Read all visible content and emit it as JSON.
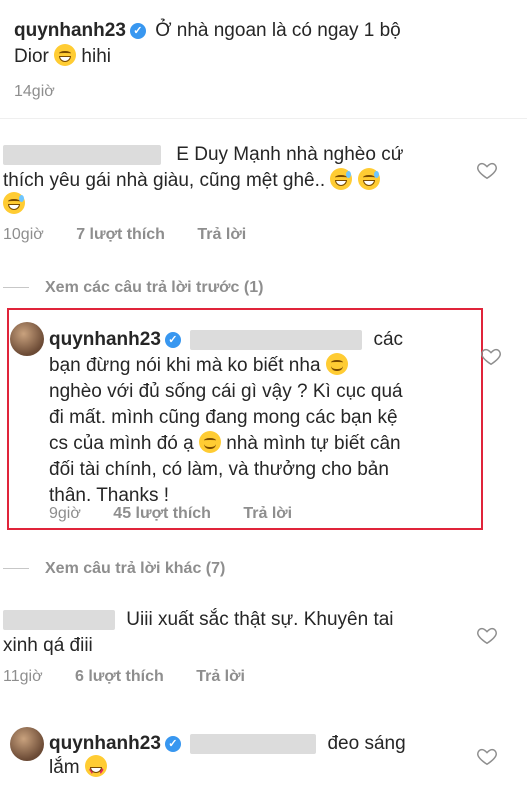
{
  "post": {
    "username": "quynhanh23",
    "caption_line1": "Ở nhà ngoan là có ngay 1 bộ",
    "caption_line2_a": "Dior",
    "caption_line2_b": "hihi",
    "time": "14giờ"
  },
  "comment1": {
    "line1": "E Duy Mạnh nhà nghèo cứ",
    "line2": "thích yêu gái nhà giàu, cũng mệt ghê..",
    "time": "10giờ",
    "likes": "7 lượt thích",
    "reply": "Trả lời"
  },
  "view_previous": "Xem các câu trả lời trước (1)",
  "reply1": {
    "username": "quynhanh23",
    "line1": "các",
    "line2": "bạn đừng nói khi mà ko biết nha",
    "line3": "nghèo với đủ sống cái gì vậy ? Kì cục quá",
    "line4": "đi mất. mình cũng đang mong các bạn kệ",
    "line5_a": "cs của mình đó ạ",
    "line5_b": "nhà mình tự biết cân",
    "line6": "đối tài chính, có làm, và thưởng cho bản",
    "line7": "thân. Thanks !",
    "time": "9giờ",
    "likes": "45 lượt thích",
    "reply": "Trả lời"
  },
  "view_other": "Xem câu trả lời khác (7)",
  "comment2": {
    "line1": "Uiii xuất sắc thật sự. Khuyên tai",
    "line2": "xinh qá điii",
    "time": "11giờ",
    "likes": "6 lượt thích",
    "reply": "Trả lời"
  },
  "reply2": {
    "username": "quynhanh23",
    "line1": "đeo sáng",
    "line2": "lắm"
  },
  "colors": {
    "highlight_box": "#e0243a",
    "verified": "#3897f0"
  }
}
